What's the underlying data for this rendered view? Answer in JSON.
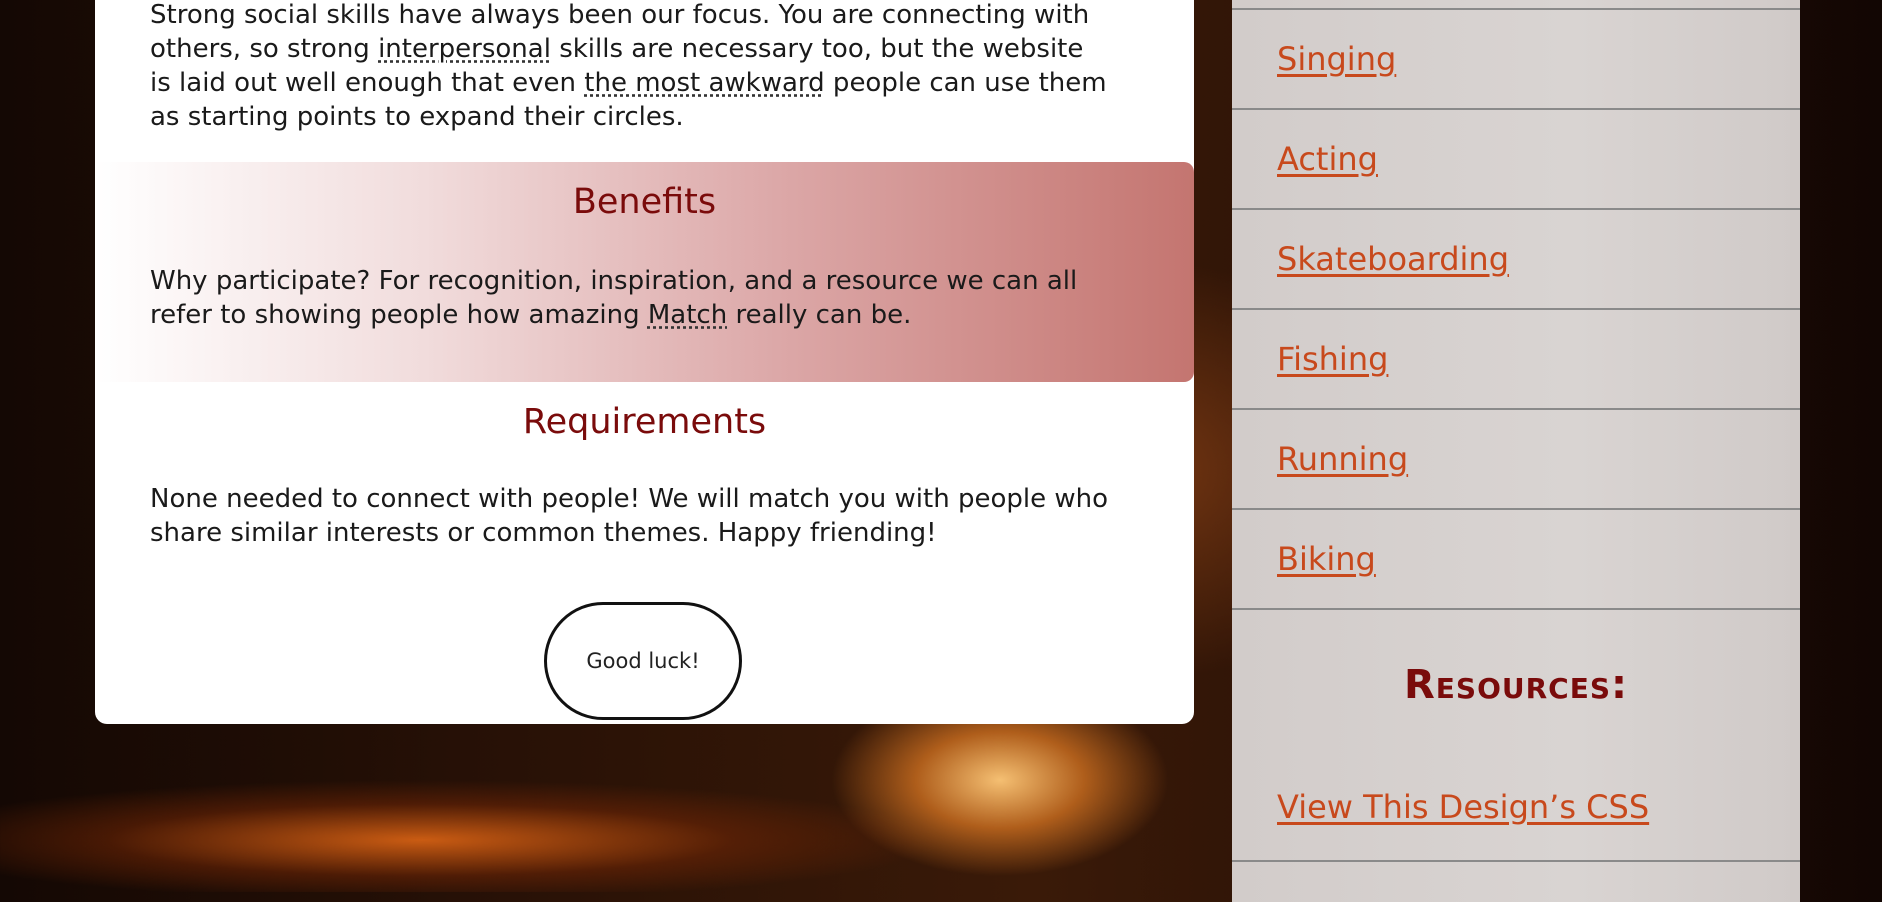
{
  "content": {
    "intro": {
      "before": "Strong social skills have always been our focus. You are connecting with others, so strong ",
      "term1": "interpersonal",
      "middle": " skills are necessary too, but the website is laid out well enough that even ",
      "term2": "the most awkward",
      "after": " people can use them as starting points to expand their circles."
    },
    "benefits": {
      "heading": "Benefits",
      "before": "Why participate? For recognition, inspiration, and a resource we can all refer to showing people how amazing ",
      "term": "Match",
      "after": " really can be."
    },
    "requirements": {
      "heading": "Requirements",
      "text": "None needed to connect with people! We will match you with people who share similar interests or common themes. Happy friending!"
    },
    "button_label": "Good luck!"
  },
  "sidebar": {
    "items": [
      {
        "label": "Singing"
      },
      {
        "label": "Acting"
      },
      {
        "label": "Skateboarding"
      },
      {
        "label": "Fishing"
      },
      {
        "label": "Running"
      },
      {
        "label": "Biking"
      }
    ],
    "resources_heading": "Resources:",
    "resources_link": "View This Design’s CSS"
  },
  "colors": {
    "heading": "#7a0b0b",
    "link": "#c8491c",
    "sidebar_bg": "#d6d0ce"
  }
}
